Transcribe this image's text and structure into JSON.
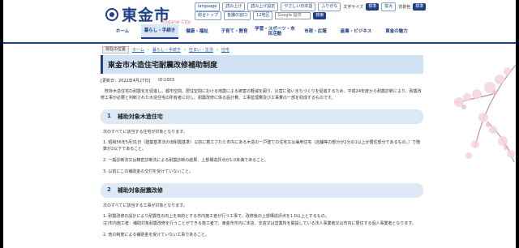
{
  "header": {
    "logo_text": "東金市",
    "logo_sub": "Togane City",
    "util": [
      "language",
      "読み上げ",
      "読み上げ設定",
      "やさしい日本語",
      "ふりがな"
    ],
    "text_size_label": "文字サイズ",
    "text_size_btn": "標準",
    "text_size_big": "拡大",
    "bg_label": "背景色",
    "bg_btn": "標準",
    "links": [
      "総合トップ",
      "各課の窓口",
      "12地区"
    ],
    "search_placeholder": "Google 提供",
    "search_btn": "検索"
  },
  "nav": [
    {
      "label": "ホーム"
    },
    {
      "label": "暮らし・手続き"
    },
    {
      "label": "健康・福祉"
    },
    {
      "label": "子育て・教育"
    },
    {
      "label": "学習・スポーツ・市民活動"
    },
    {
      "label": "市政・広報"
    },
    {
      "label": "産業・ビジネス"
    },
    {
      "label": "東金の魅力"
    }
  ],
  "breadcrumb": {
    "tag": "現在の位置",
    "items": [
      "ホーム",
      "暮らし・手続き",
      "住まい・生活",
      "住宅"
    ]
  },
  "page": {
    "title": "東金市木造住宅耐震改修補助制度",
    "updated": "[更新日：2022年4月27日]",
    "id": "ID:1003",
    "intro": "既存木造住宅の耐震化を促進し、都市空間、居住空間における地震による被害の軽減を図り、災害に強いまちづくりを促進するため、平成24年度から耐震診断により、耐震改修工事が必要と判断された木造住宅の所有者に対し、耐震改修に係る設計費、工事監理費及び工事費の一部を助成するものです。"
  },
  "sections": [
    {
      "num": "1",
      "title": "補助対象木造住宅",
      "lead": "次のすべてに該当する住宅が対象となります。",
      "items": [
        "1. 昭和56年5月31日（建築基準法の旧耐震基準）以前に着工された市内にある木造の一戸建ての住宅又は兼用住宅（店舗等の部分が2分の1以上が居住部分であるもの。）で階数が2以下であること。",
        "2. 一般診断法又は精密診断法による耐震診断の結果、上部構造評点が1.0未満であること。",
        "3. 以前にこの補助金の交付を受けていないこと。"
      ]
    },
    {
      "num": "2",
      "title": "補助対象耐震改修",
      "lead": "次のすべてに該当する工事が対象となります。",
      "items": [
        "1. 耐震改修の設計により耐震性の向上を目的とする市内施工者が行う工事で、改修後の上部構造評点を1.0以上とするもの。",
        "注)市内施工者：補助対象耐震改修を行うことができる施工者で、東金市市内に本店、支店又は営業所を開設している法人事業者又は市内に居住する個人事業者となります。",
        "2. 他の制度による補助金を受けていない工事であること。"
      ]
    }
  ]
}
